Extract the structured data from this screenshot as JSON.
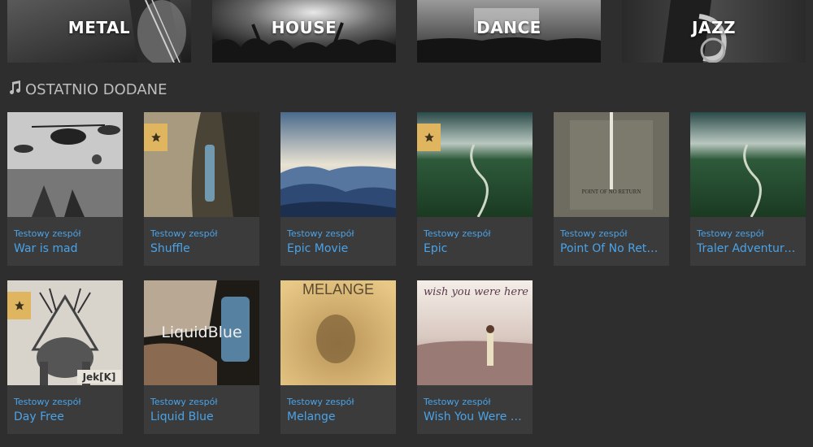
{
  "genres": [
    {
      "label": "METAL",
      "icon": "guitar-image"
    },
    {
      "label": "HOUSE",
      "icon": "crowd-image"
    },
    {
      "label": "DANCE",
      "icon": "stage-image"
    },
    {
      "label": "JAZZ",
      "icon": "saxophone-image"
    }
  ],
  "section": {
    "title": "OSTATNIO DODANE",
    "icon": "music-note-icon"
  },
  "albums": [
    {
      "band": "Testowy zespół",
      "title": "War is mad",
      "featured": false
    },
    {
      "band": "Testowy zespół",
      "title": "Shuffle",
      "featured": true
    },
    {
      "band": "Testowy zespół",
      "title": "Epic Movie",
      "featured": false
    },
    {
      "band": "Testowy zespół",
      "title": "Epic",
      "featured": true
    },
    {
      "band": "Testowy zespół",
      "title": "Point Of No Return",
      "featured": false,
      "cover_text": "POINT OF NO RETURN"
    },
    {
      "band": "Testowy zespół",
      "title": "Traler Adventure…",
      "featured": false
    },
    {
      "band": "Testowy zespół",
      "title": "Day Free",
      "featured": true,
      "cover_text": "Jek[K]"
    },
    {
      "band": "Testowy zespół",
      "title": "Liquid Blue",
      "featured": false,
      "cover_text": "LiquidBlue"
    },
    {
      "band": "Testowy zespół",
      "title": "Melange",
      "featured": false,
      "cover_text": "MELANGE"
    },
    {
      "band": "Testowy zespół",
      "title": "Wish You Were H…",
      "featured": false,
      "cover_text": "wish you were here"
    }
  ],
  "colors": {
    "link": "#4aa3e8",
    "star_badge": "#e0b560",
    "card": "#3b3b3b",
    "background": "#2e2e2e"
  }
}
